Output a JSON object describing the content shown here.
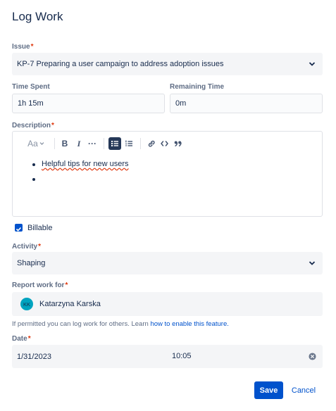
{
  "dialog": {
    "title": "Log Work"
  },
  "issue": {
    "label": "Issue",
    "value": "KP-7 Preparing a user campaign to address adoption issues"
  },
  "time_spent": {
    "label": "Time Spent",
    "value": "1h 15m"
  },
  "remaining_time": {
    "label": "Remaining Time",
    "value": "0m"
  },
  "description": {
    "label": "Description",
    "toolbar": {
      "text_style": "Aa",
      "bold": "B",
      "italic": "I",
      "more": "···"
    },
    "items": [
      "Helpful tips for new users",
      ""
    ]
  },
  "billable": {
    "label": "Billable",
    "checked": true
  },
  "activity": {
    "label": "Activity",
    "value": "Shaping"
  },
  "report_work_for": {
    "label": "Report work for",
    "avatar_initials": "KK",
    "user": "Katarzyna Karska"
  },
  "help": {
    "text": "If permitted you can log work for others. Learn ",
    "link": "how to enable this feature."
  },
  "date": {
    "label": "Date",
    "date": "1/31/2023",
    "time": "10:05"
  },
  "actions": {
    "save": "Save",
    "cancel": "Cancel"
  },
  "colors": {
    "primary": "#0052cc",
    "required": "#de350b",
    "avatar": "#00a3bf"
  }
}
